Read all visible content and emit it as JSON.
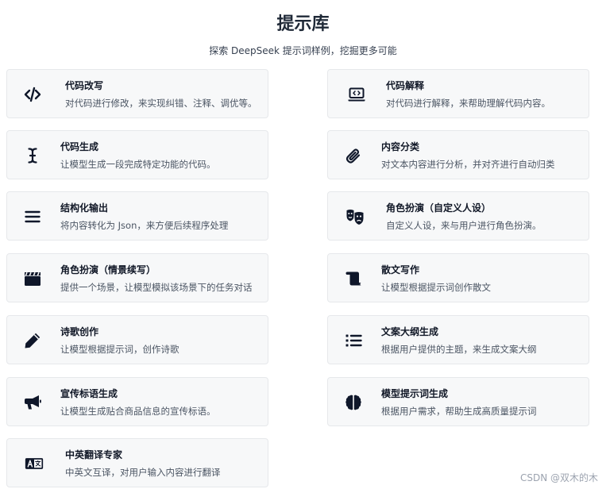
{
  "header": {
    "title": "提示库",
    "subtitle": "探索 DeepSeek 提示词样例，挖掘更多可能"
  },
  "cards": [
    {
      "title": "代码改写",
      "desc": "对代码进行修改，来实现纠错、注释、调优等。",
      "icon": "code-icon"
    },
    {
      "title": "代码解释",
      "desc": "对代码进行解释，来帮助理解代码内容。",
      "icon": "laptop-code-icon"
    },
    {
      "title": "代码生成",
      "desc": "让模型生成一段完成特定功能的代码。",
      "icon": "text-cursor-icon"
    },
    {
      "title": "内容分类",
      "desc": "对文本内容进行分析，并对齐进行自动归类",
      "icon": "paperclip-icon"
    },
    {
      "title": "结构化输出",
      "desc": "将内容转化为 Json，来方便后续程序处理",
      "icon": "bars-icon"
    },
    {
      "title": "角色扮演（自定义人设）",
      "desc": "自定义人设，来与用户进行角色扮演。",
      "icon": "masks-theater-icon"
    },
    {
      "title": "角色扮演（情景续写）",
      "desc": "提供一个场景，让模型模拟该场景下的任务对话",
      "icon": "clapperboard-icon"
    },
    {
      "title": "散文写作",
      "desc": "让模型根据提示词创作散文",
      "icon": "scroll-icon"
    },
    {
      "title": "诗歌创作",
      "desc": "让模型根据提示词，创作诗歌",
      "icon": "pencil-icon"
    },
    {
      "title": "文案大纲生成",
      "desc": "根据用户提供的主题，来生成文案大纲",
      "icon": "list-icon"
    },
    {
      "title": "宣传标语生成",
      "desc": "让模型生成贴合商品信息的宣传标语。",
      "icon": "megaphone-icon"
    },
    {
      "title": "模型提示词生成",
      "desc": "根据用户需求，帮助生成高质量提示词",
      "icon": "brain-icon"
    },
    {
      "title": "中英翻译专家",
      "desc": "中英文互译，对用户输入内容进行翻译",
      "icon": "language-icon"
    }
  ],
  "watermark": "CSDN @双木的木",
  "colors": {
    "icon": "#0f172a",
    "card_bg": "#f7f8f9",
    "card_border": "#e6e8eb"
  }
}
